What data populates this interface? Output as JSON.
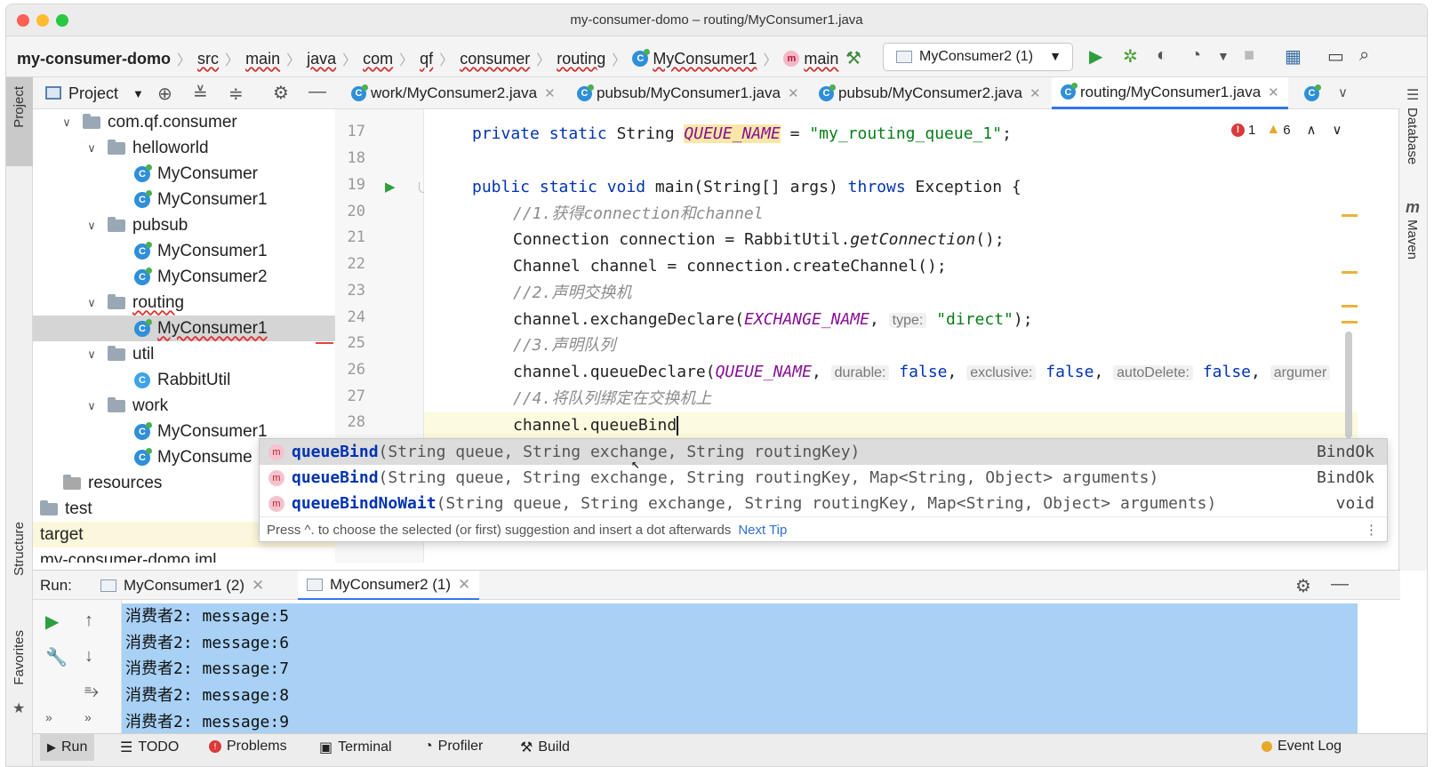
{
  "window": {
    "title": "my-consumer-domo – routing/MyConsumer1.java"
  },
  "breadcrumb": [
    "my-consumer-domo",
    "src",
    "main",
    "java",
    "com",
    "qf",
    "consumer",
    "routing",
    "MyConsumer1",
    "main"
  ],
  "toolbar": {
    "run_config": "MyConsumer2 (1)"
  },
  "project_panel": {
    "title": "Project",
    "tree": [
      {
        "label": "com.qf.consumer",
        "type": "folder",
        "level": 0,
        "expanded": true
      },
      {
        "label": "helloworld",
        "type": "folder",
        "level": 1,
        "expanded": true
      },
      {
        "label": "MyConsumer",
        "type": "class-run",
        "level": 2
      },
      {
        "label": "MyConsumer1",
        "type": "class-run",
        "level": 2
      },
      {
        "label": "pubsub",
        "type": "folder",
        "level": 1,
        "expanded": true
      },
      {
        "label": "MyConsumer1",
        "type": "class-run",
        "level": 2
      },
      {
        "label": "MyConsumer2",
        "type": "class-run",
        "level": 2
      },
      {
        "label": "routing",
        "type": "folder",
        "level": 1,
        "expanded": true,
        "error": true
      },
      {
        "label": "MyConsumer1",
        "type": "class-run",
        "level": 2,
        "selected": true,
        "error": true
      },
      {
        "label": "util",
        "type": "folder",
        "level": 1,
        "expanded": true
      },
      {
        "label": "RabbitUtil",
        "type": "class",
        "level": 2
      },
      {
        "label": "work",
        "type": "folder",
        "level": 1,
        "expanded": true
      },
      {
        "label": "MyConsumer1",
        "type": "class-run",
        "level": 2
      },
      {
        "label": "MyConsume",
        "type": "class-run",
        "level": 2
      },
      {
        "label": "resources",
        "type": "resources",
        "level": 0
      },
      {
        "label": "test",
        "type": "folder",
        "level": -1
      },
      {
        "label": "target",
        "type": "excluded",
        "level": -2,
        "highlight": true
      },
      {
        "label": "my-consumer-domo.iml",
        "type": "file",
        "level": -2
      }
    ]
  },
  "editor_tabs": [
    {
      "label": "work/MyConsumer2.java",
      "active": false
    },
    {
      "label": "pubsub/MyConsumer1.java",
      "active": false
    },
    {
      "label": "pubsub/MyConsumer2.java",
      "active": false
    },
    {
      "label": "routing/MyConsumer1.java",
      "active": true
    }
  ],
  "inspections": {
    "errors": "1",
    "warnings": "6"
  },
  "code": {
    "line_numbers": [
      "17",
      "18",
      "19",
      "20",
      "21",
      "22",
      "23",
      "24",
      "25",
      "26",
      "27",
      "28"
    ],
    "l17": {
      "a": "private static ",
      "b": "String ",
      "c": "QUEUE_NAME",
      "d": " = ",
      "e": "\"my_routing_queue_1\"",
      "f": ";"
    },
    "l19": {
      "a": "public static void ",
      "b": "main(String[] args) ",
      "c": "throws ",
      "d": "Exception {"
    },
    "l20": "//1.获得connection和channel",
    "l21": {
      "a": "Connection connection = RabbitUtil.",
      "b": "getConnection",
      "c": "();"
    },
    "l22": "Channel channel = connection.createChannel();",
    "l23": "//2.声明交换机",
    "l24": {
      "a": "channel.exchangeDeclare(",
      "b": "EXCHANGE_NAME",
      ",": ", ",
      "hint": "type:",
      "c": " \"direct\"",
      "d": ");"
    },
    "l25": "//3.声明队列",
    "l26": {
      "a": "channel.queueDeclare(",
      "b": "QUEUE_NAME",
      "c": ", ",
      "h1": "durable:",
      "v1": " false",
      "s1": ", ",
      "h2": "exclusive:",
      "v2": " false",
      "s2": ", ",
      "h3": "autoDelete:",
      "v3": " false",
      "s3": ", ",
      "h4": "argumer"
    },
    "l27": "//4.将队列绑定在交换机上",
    "l28": "channel.queueBind"
  },
  "completion": {
    "items": [
      {
        "name": "queueBind",
        "sig": "(String queue, String exchange, String routingKey)",
        "ret": "BindOk"
      },
      {
        "name": "queueBind",
        "sig": "(String queue, String exchange, String routingKey, Map<String, Object> arguments)",
        "ret": "BindOk"
      },
      {
        "name": "queueBindNoWait",
        "sig": "(String queue, String exchange, String routingKey, Map<String, Object> arguments)",
        "ret": "void"
      }
    ],
    "footer": "Press ^. to choose the selected (or first) suggestion and insert a dot afterwards",
    "next_tip": "Next Tip"
  },
  "run_panel": {
    "label": "Run:",
    "tabs": [
      "MyConsumer1 (2)",
      "MyConsumer2 (1)"
    ],
    "output": [
      "消费者2: message:5",
      "消费者2: message:6",
      "消费者2: message:7",
      "消费者2: message:8",
      "消费者2: message:9"
    ]
  },
  "side_labels": {
    "project": "Project",
    "structure": "Structure",
    "favorites": "Favorites",
    "database": "Database",
    "maven": "Maven"
  },
  "status_tabs": [
    "Run",
    "TODO",
    "Problems",
    "Terminal",
    "Profiler",
    "Build"
  ],
  "event_log": "Event Log",
  "colors": {
    "accent": "#3574f0",
    "keyword": "#0033b3",
    "string": "#067d17",
    "field": "#871094",
    "selection": "#a8d1f5"
  }
}
